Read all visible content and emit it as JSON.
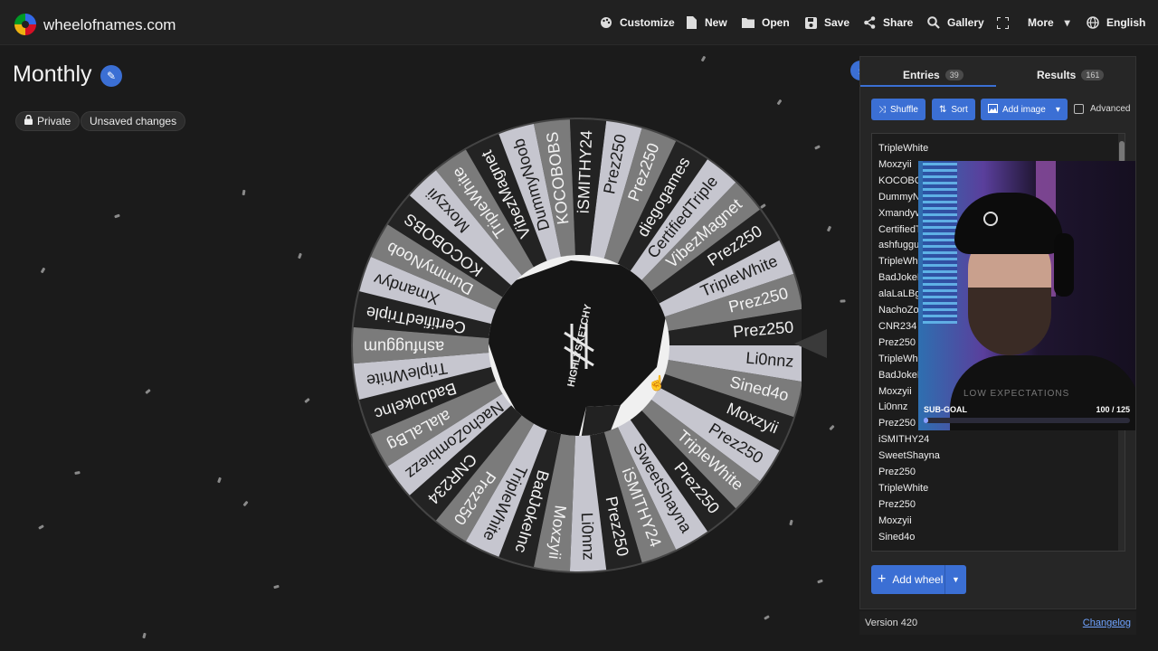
{
  "site": {
    "name": "wheelofnames.com"
  },
  "nav": {
    "customize": "Customize",
    "new": "New",
    "open": "Open",
    "save": "Save",
    "share": "Share",
    "gallery": "Gallery",
    "more": "More",
    "language": "English"
  },
  "wheel": {
    "title": "Monthly",
    "private_label": "Private",
    "unsaved_label": "Unsaved changes",
    "center_text": "HIGHLYSKETCHY",
    "colors": {
      "light": "#c6c6cf",
      "mid": "#7b7b7b",
      "dark": "#232323",
      "text_dark": "#1b1b1b",
      "text_light": "#f2f2f2"
    },
    "segments": [
      "Prez250",
      "Prez250",
      "diegogames",
      "CertifiedTriple",
      "VibezMagnet",
      "Prez250",
      "TripleWhite",
      "Prez250",
      "Prez250",
      "Li0nnz",
      "Sined4o",
      "Moxzyii",
      "Prez250",
      "TripleWhite",
      "Prez250",
      "SweetShayna",
      "iSMITHY24",
      "Prez250",
      "Li0nnz",
      "Moxzyii",
      "BadJokeInc",
      "TripleWhite",
      "Prez250",
      "CNR234",
      "NachoZombiezz",
      "alaLaLBg",
      "BadJokeInc",
      "TripleWhite",
      "ashfuggum",
      "CertifiedTriple",
      "Xmandyv",
      "DummyNoob",
      "KOCOBOBS",
      "Moxzyii",
      "TripleWhite",
      "VibezMagnet",
      "DummyNoob",
      "KOCOBOBS",
      "iSMITHY24"
    ]
  },
  "panel": {
    "entries_tab": "Entries",
    "entries_count": "39",
    "results_tab": "Results",
    "results_count": "161",
    "shuffle": "Shuffle",
    "sort": "Sort",
    "add_image": "Add image",
    "advanced": "Advanced",
    "entries": [
      "TripleWhite",
      "Moxzyii",
      "KOCOBOBS",
      "DummyNoob",
      "Xmandyv",
      "CertifiedTriple",
      "ashfuggum",
      "TripleWhite",
      "BadJokeInc",
      "alaLaLBg",
      "NachoZombiezz",
      "CNR234",
      "Prez250",
      "TripleWhite",
      "BadJokeInc",
      "Moxzyii",
      "Li0nnz",
      "Prez250",
      "iSMITHY24",
      "SweetShayna",
      "Prez250",
      "TripleWhite",
      "Prez250",
      "Moxzyii",
      "Sined4o"
    ],
    "add_wheel": "Add wheel",
    "version": "Version 420",
    "changelog": "Changelog"
  },
  "stream_overlay": {
    "shirt_text": "LOW EXPECTATIONS",
    "subgoal_label": "SUB-GOAL",
    "subgoal_value": "100 / 125",
    "subgoal_progress": 0.02
  }
}
